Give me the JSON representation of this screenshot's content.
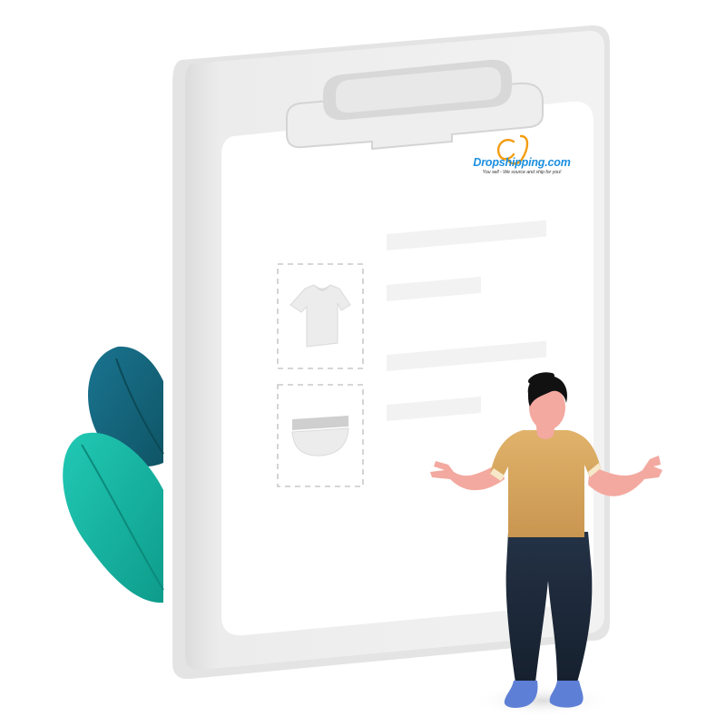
{
  "brand": {
    "name": "Dropshipping.com",
    "tagline": "You sell - We source and ship for you!",
    "monogram": "CJ",
    "colors": {
      "monogram": "#f39c12",
      "name": "#1a8fe0"
    }
  },
  "order_items": [
    {
      "icon": "t-shirt-icon"
    },
    {
      "icon": "bowl-icon"
    }
  ],
  "illustration": {
    "subject": "person-shrugging",
    "colors": {
      "shirt": "#d9a960",
      "pants": "#1e2a3a",
      "shoes": "#5d7fd6",
      "leaf_dark": "#15677d",
      "leaf_light": "#16b8a6"
    }
  }
}
